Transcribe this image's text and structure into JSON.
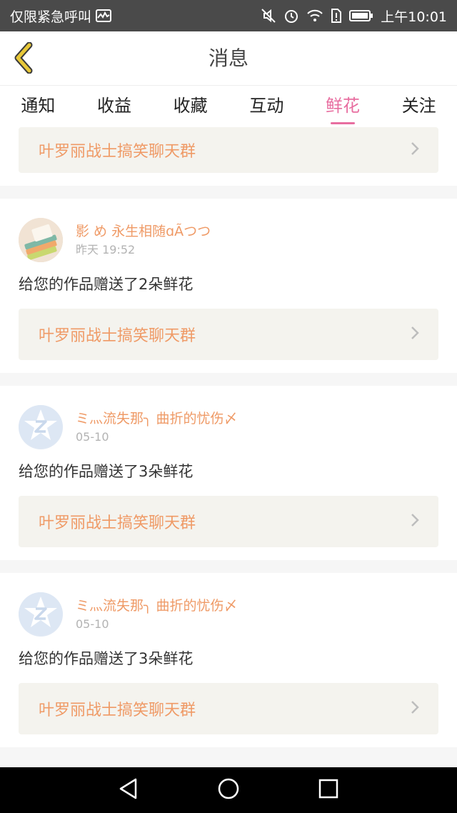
{
  "status_bar": {
    "carrier": "仅限紧急呼叫",
    "time": "上午10:01",
    "icons": [
      "activity-icon",
      "mute-icon",
      "alarm-icon",
      "wifi-icon",
      "sim-icon",
      "battery-icon"
    ]
  },
  "nav": {
    "title": "消息",
    "back_icon": "chevron-left-icon"
  },
  "tabs": [
    {
      "label": "通知",
      "active": false
    },
    {
      "label": "收益",
      "active": false
    },
    {
      "label": "收藏",
      "active": false
    },
    {
      "label": "互动",
      "active": false
    },
    {
      "label": "鲜花",
      "active": true
    },
    {
      "label": "关注",
      "active": false
    }
  ],
  "top_partial": {
    "group_name": "叶罗丽战士搞笑聊天群"
  },
  "messages": [
    {
      "username": "影 め 永生相随ɑÃつつ",
      "time": "昨天 19:52",
      "text": "给您的作品赠送了2朵鲜花",
      "group_name": "叶罗丽战士搞笑聊天群",
      "avatar_type": "photo"
    },
    {
      "username": "ミ灬流失那╮ 曲折的忧伤〆",
      "time": "05-10",
      "text": "给您的作品赠送了3朵鲜花",
      "group_name": "叶罗丽战士搞笑聊天群",
      "avatar_type": "default"
    },
    {
      "username": "ミ灬流失那╮ 曲折的忧伤〆",
      "time": "05-10",
      "text": "给您的作品赠送了3朵鲜花",
      "group_name": "叶罗丽战士搞笑聊天群",
      "avatar_type": "default"
    }
  ],
  "colors": {
    "accent": "#e86ea0",
    "username": "#ef9a66",
    "back_icon": "#e8c838",
    "status_bar": "#4a4a4a"
  }
}
